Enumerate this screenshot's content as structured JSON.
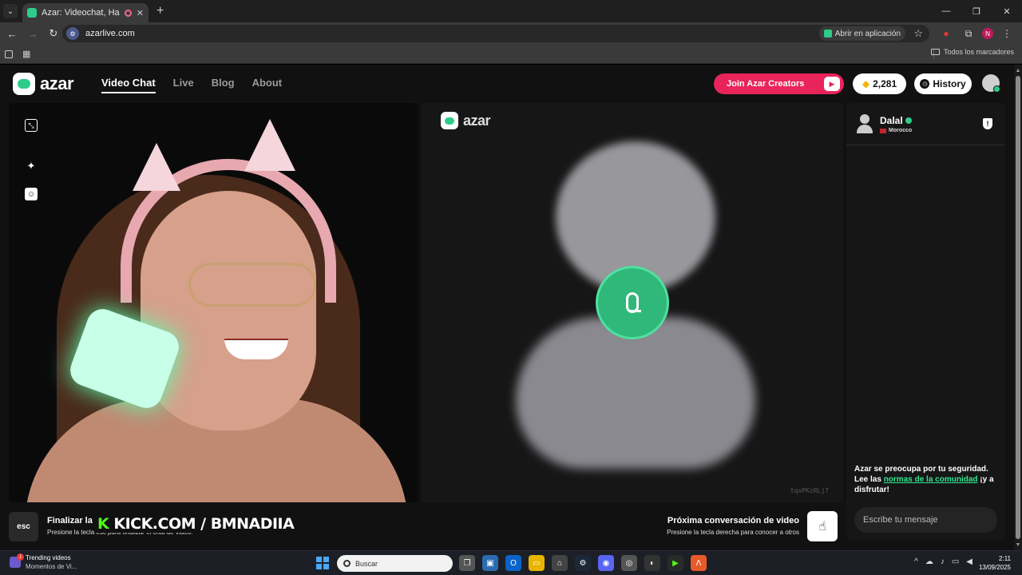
{
  "browser": {
    "tab_title": "Azar: Videochat, Haz nuevo",
    "tab_close": "✕",
    "new_tab": "+",
    "url": "azarlive.com",
    "open_in_app": "Abrir en aplicación",
    "bookmarks_all": "Todos los marcadores"
  },
  "header": {
    "logo_text": "azar",
    "nav": [
      {
        "label": "Video Chat",
        "active": true
      },
      {
        "label": "Live",
        "active": false
      },
      {
        "label": "Blog",
        "active": false
      },
      {
        "label": "About",
        "active": false
      }
    ],
    "creators_button": "Join Azar Creators",
    "gems_count": "2,281",
    "history_button": "History"
  },
  "remote": {
    "logo_text": "azar",
    "session_code": "tqxPKzRLj7"
  },
  "chat": {
    "peer_name": "Dalal",
    "peer_country": "Morocco",
    "safety_text_1": "Azar se preocupa por tu seguridad. Lee las ",
    "safety_link": "normas de la comunidad",
    "safety_text_2": " ¡y a disfrutar!",
    "message_placeholder": "Escribe tu mensaje"
  },
  "footer": {
    "esc_key": "esc",
    "end_title": "Finalizar la",
    "end_hint": "Presione la tecla esc para finalizar el chat de video.",
    "overlay_text_k": "K",
    "overlay_text_rest": " KICK.COM / BMNADIIA",
    "next_title": "Próxima conversación de video",
    "next_hint": "Presione la tecla derecha para conocer a otros"
  },
  "taskbar": {
    "news_badge": "1",
    "news_title": "Trending videos",
    "news_sub": "Momentos de Vi...",
    "search_placeholder": "Buscar",
    "time": "2:11",
    "date": "13/09/2025"
  },
  "colors": {
    "accent": "#2ecc8a",
    "creators": "#e8245a",
    "link": "#2ee890"
  }
}
